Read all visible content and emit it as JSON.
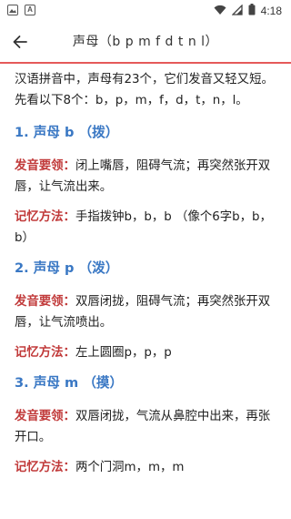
{
  "status_bar": {
    "time": "4:18",
    "icons": [
      "gallery-icon",
      "text-a-icon",
      "wifi-icon",
      "signal-icon",
      "battery-icon"
    ]
  },
  "app_bar": {
    "back_icon": "arrow-left-icon",
    "title": "声母（b p m f d t n l）"
  },
  "colors": {
    "heading": "#3a78c4",
    "label": "#c13a3a",
    "divider": "#e55a5a"
  },
  "content": {
    "intro": "汉语拼音中，声母有23个，它们发音又轻又短。先看以下8个：b，p，m，f，d，t，n，l。",
    "sections": [
      {
        "heading": "1. 声母 b （拨）",
        "pronunciation_label": "发音要领：",
        "pronunciation": "闭上嘴唇，阻碍气流；再突然张开双唇，让气流出来。",
        "memory_label": "记忆方法：",
        "memory": "手指拨钟b，b，b （像个6字b，b，b）"
      },
      {
        "heading": "2. 声母 p （泼）",
        "pronunciation_label": "发音要领：",
        "pronunciation": "双唇闭拢，阻碍气流；再突然张开双唇，让气流喷出。",
        "memory_label": "记忆方法：",
        "memory": "左上圆圈p，p，p"
      },
      {
        "heading": "3. 声母 m （摸）",
        "pronunciation_label": "发音要领：",
        "pronunciation": "双唇闭拢，气流从鼻腔中出来，再张开口。",
        "memory_label": "记忆方法：",
        "memory": "两个门洞m，m，m"
      }
    ]
  }
}
